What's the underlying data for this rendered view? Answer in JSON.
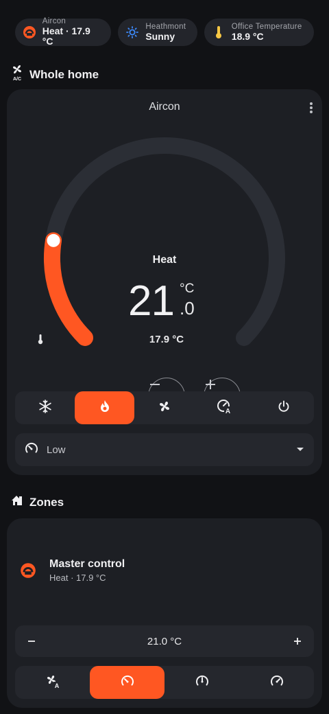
{
  "chips": [
    {
      "title": "Aircon",
      "value": "Heat · 17.9 °C",
      "icon": "aircon-heat-icon",
      "color": "#ff5722"
    },
    {
      "title": "Heathmont",
      "value": "Sunny",
      "icon": "sun-icon",
      "color": "#3d8bfd"
    },
    {
      "title": "Office Temperature",
      "value": "18.9 °C",
      "icon": "thermometer-icon",
      "color": "#f6c744"
    }
  ],
  "whole_home": {
    "section_title": "Whole home",
    "card_title": "Aircon",
    "mode_label": "Heat",
    "target_int": "21",
    "target_dec": ".0",
    "unit": "°C",
    "current": "17.9 °C",
    "setpoint_fraction": 0.2,
    "modes": [
      "cool-icon",
      "heat-icon",
      "fan-icon",
      "auto-icon",
      "power-icon"
    ],
    "active_mode": "heat-icon",
    "fan_speed": "Low"
  },
  "zones": {
    "section_title": "Zones",
    "master_name": "Master control",
    "master_sub": "Heat · 17.9 °C",
    "setpoint": "21.0 °C",
    "fan_modes": [
      "fan-auto-icon",
      "speed-low-icon",
      "speed-medium-icon",
      "speed-high-icon"
    ],
    "active_fan_mode": "speed-low-icon"
  },
  "colors": {
    "accent": "#ff5722",
    "card": "#1d1f24",
    "background": "#111215"
  }
}
